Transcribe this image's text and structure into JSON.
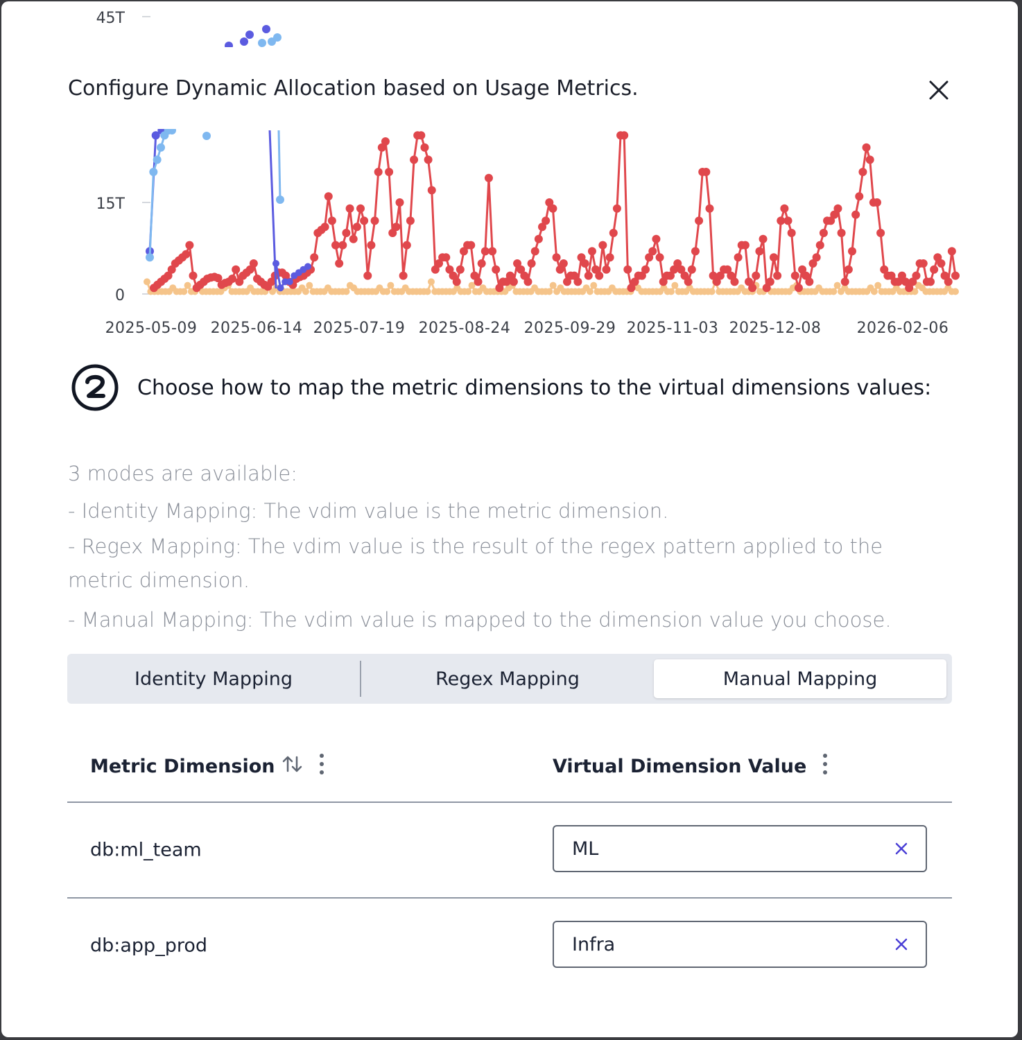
{
  "modal": {
    "title": "Configure Dynamic Allocation based on Usage Metrics.",
    "close_icon": "close-icon"
  },
  "chart_data": {
    "type": "line",
    "y_ticks": [
      "0",
      "15T",
      "45T"
    ],
    "x_ticks": [
      "2025-05-09",
      "2025-06-14",
      "2025-07-19",
      "2025-08-24",
      "2025-09-29",
      "2025-11-03",
      "2025-12-08",
      "2026-02-06"
    ],
    "colors": {
      "red": "#e0474c",
      "dark_blue": "#5b5be0",
      "light_blue": "#7fb8f0",
      "orange": "#f5c48a"
    },
    "series_red": [
      1,
      1.5,
      2,
      2.5,
      3,
      4,
      5,
      5.5,
      6,
      6.5,
      8,
      3,
      1,
      1.5,
      2,
      2.5,
      2.7,
      2.8,
      2.6,
      1.5,
      1.8,
      2,
      2.5,
      4,
      2,
      3,
      3.5,
      4,
      5,
      2.5,
      2,
      1.5,
      1.2,
      2,
      3,
      3.5,
      3.5,
      3,
      2,
      1.5,
      2.5,
      2.8,
      3,
      3.5,
      4,
      6,
      10,
      10.5,
      11,
      16,
      12,
      8,
      5,
      8,
      10,
      14,
      9,
      11,
      14,
      12,
      3,
      8,
      12,
      20,
      24,
      25,
      20,
      10,
      11,
      15,
      3,
      8,
      12,
      22,
      26,
      26,
      24,
      22,
      17,
      4,
      5,
      6,
      6,
      4,
      3,
      2,
      4,
      7,
      8,
      8,
      3,
      2,
      5,
      7,
      19,
      7,
      4,
      1,
      2,
      2,
      3,
      2,
      5,
      4,
      3,
      2,
      5,
      7,
      9,
      11,
      12,
      15,
      14,
      6,
      4,
      5,
      2,
      3,
      3,
      2,
      6,
      5,
      3,
      7,
      4,
      3,
      8,
      4,
      6,
      10,
      14,
      26,
      26,
      4,
      1,
      2,
      3,
      3,
      4,
      6,
      7,
      9,
      6,
      2,
      3,
      3,
      4,
      5,
      4,
      3,
      2,
      4,
      7,
      12,
      20,
      20,
      14,
      3,
      2,
      3,
      4,
      4,
      3,
      2,
      6,
      8,
      8,
      2,
      1,
      3,
      7,
      9,
      1,
      2,
      6,
      3,
      12,
      14,
      12,
      10,
      3,
      1,
      4,
      3,
      2,
      5,
      6,
      8,
      10,
      12,
      12,
      13,
      14,
      10,
      2,
      4,
      7,
      13,
      16,
      20,
      24,
      22,
      15,
      15,
      10,
      4,
      3,
      3,
      2,
      2,
      3,
      2,
      1,
      2,
      3,
      5,
      5,
      2,
      2,
      4,
      6,
      5,
      3,
      2,
      7,
      3
    ],
    "series_dark_blue": [
      7,
      26,
      28,
      30,
      32,
      34,
      30,
      26,
      40,
      45,
      30,
      5,
      1,
      2,
      2,
      3,
      3.5,
      4,
      4.5
    ],
    "series_light_blue": [
      6,
      20,
      22,
      24,
      26,
      28,
      29,
      26,
      25,
      15,
      0
    ],
    "series_orange_level": 0.4
  },
  "step": {
    "number_icon": "step-2-icon",
    "text": "Choose how to map the metric dimensions to the virtual dimensions values:"
  },
  "description": {
    "line1": "3 modes are available:",
    "line2": "- Identity Mapping: The vdim value is the metric dimension.",
    "line3": "- Regex Mapping: The vdim value is the result of the regex pattern applied to the metric dimension.",
    "line4": "- Manual Mapping: The vdim value is mapped to the dimension value you choose."
  },
  "modes": [
    {
      "label": "Identity Mapping",
      "active": false
    },
    {
      "label": "Regex Mapping",
      "active": false
    },
    {
      "label": "Manual Mapping",
      "active": true
    }
  ],
  "table": {
    "columns": [
      {
        "label": "Metric Dimension"
      },
      {
        "label": "Virtual Dimension Value"
      }
    ],
    "rows": [
      {
        "metric": "db:ml_team",
        "value": "ML"
      },
      {
        "metric": "db:app_prod",
        "value": "Infra"
      }
    ]
  }
}
